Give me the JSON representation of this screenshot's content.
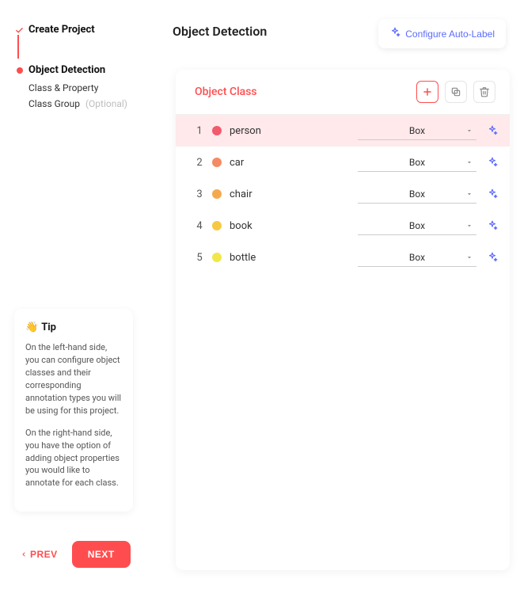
{
  "sidebar": {
    "steps": [
      {
        "label": "Create Project",
        "status": "done"
      },
      {
        "label": "Object Detection",
        "status": "current"
      }
    ],
    "subitems": [
      {
        "label": "Class & Property",
        "optional": ""
      },
      {
        "label": "Class Group",
        "optional": "(Optional)"
      }
    ]
  },
  "tip": {
    "heading": "Tip",
    "emoji": "👋",
    "p1": "On the left-hand side, you can configure object classes and their corresponding annotation types you will be using for this project.",
    "p2": "On the right-hand side, you have the option of adding object properties you would like to annotate for each class."
  },
  "nav": {
    "prev": "PREV",
    "next": "NEXT"
  },
  "header": {
    "title": "Object Detection",
    "autolabel": "Configure Auto-Label"
  },
  "panel": {
    "title": "Object Class",
    "classes": [
      {
        "index": "1",
        "name": "person",
        "color": "#f15b6c",
        "type": "Box",
        "selected": true
      },
      {
        "index": "2",
        "name": "car",
        "color": "#f58b64",
        "type": "Box",
        "selected": false
      },
      {
        "index": "3",
        "name": "chair",
        "color": "#f5a94d",
        "type": "Box",
        "selected": false
      },
      {
        "index": "4",
        "name": "book",
        "color": "#f6c945",
        "type": "Box",
        "selected": false
      },
      {
        "index": "5",
        "name": "bottle",
        "color": "#f1e748",
        "type": "Box",
        "selected": false
      }
    ]
  }
}
